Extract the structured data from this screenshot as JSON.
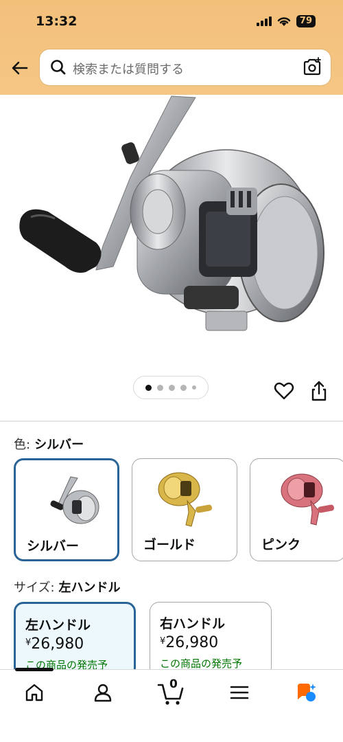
{
  "status_bar": {
    "time": "13:32",
    "battery": "79"
  },
  "header": {
    "search_placeholder": "検索または質問する"
  },
  "product": {
    "image_icon": "baitcasting-reel-silver",
    "gallery_dots": 5,
    "gallery_active_index": 0
  },
  "color": {
    "label": "色:",
    "selected": "シルバー",
    "options": [
      {
        "name": "シルバー",
        "color": "#b9bcc0",
        "selected": true
      },
      {
        "name": "ゴールド",
        "color": "#d9b64a",
        "selected": false
      },
      {
        "name": "ピンク",
        "color": "#d8737d",
        "selected": false
      }
    ]
  },
  "size": {
    "label": "サイズ:",
    "selected": "左ハンドル",
    "options": [
      {
        "name": "左ハンドル",
        "yen": "¥",
        "price": "26,980",
        "note": "この商品の発売予",
        "selected": true
      },
      {
        "name": "右ハンドル",
        "yen": "¥",
        "price": "26,980",
        "note": "この商品の発売予",
        "selected": false
      }
    ]
  },
  "nav": {
    "items": [
      "home-icon",
      "account-icon",
      "cart-icon",
      "menu-icon",
      "rufus-icon"
    ],
    "cart_count": "0"
  },
  "colors": {
    "header_bg": "#f3c07a",
    "selected_border": "#2a6496",
    "note_green": "#007600"
  }
}
